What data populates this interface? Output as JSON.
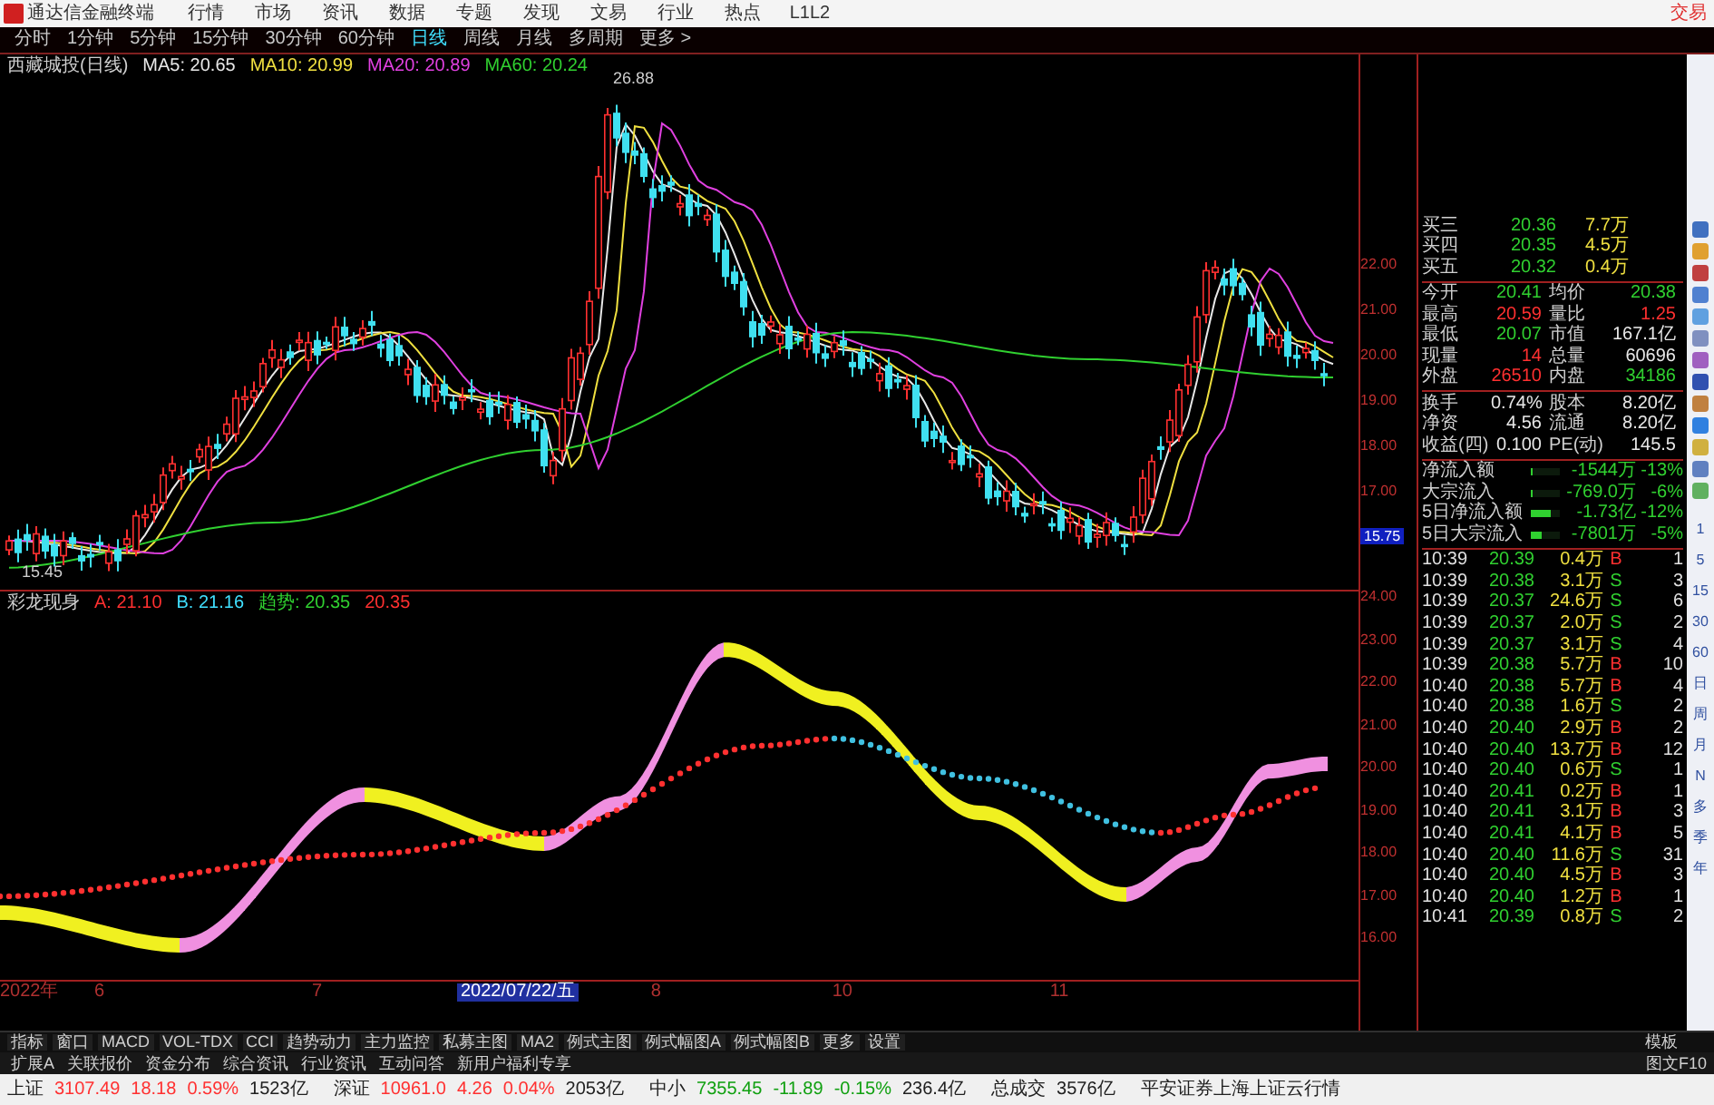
{
  "menu_bar": {
    "app_title": "通达信金融终端",
    "items": [
      "行情",
      "市场",
      "资讯",
      "数据",
      "专题",
      "发现",
      "文易",
      "行业",
      "热点",
      "L1L2"
    ],
    "trade": "交易"
  },
  "period_bar": {
    "items": [
      {
        "label": "分时",
        "selected": false
      },
      {
        "label": "1分钟",
        "selected": false
      },
      {
        "label": "5分钟",
        "selected": false
      },
      {
        "label": "15分钟",
        "selected": false
      },
      {
        "label": "30分钟",
        "selected": false
      },
      {
        "label": "60分钟",
        "selected": false
      },
      {
        "label": "日线",
        "selected": true
      },
      {
        "label": "周线",
        "selected": false
      },
      {
        "label": "月线",
        "selected": false
      },
      {
        "label": "多周期",
        "selected": false
      },
      {
        "label": "更多 >",
        "selected": false
      }
    ]
  },
  "info_bar": {
    "stock": "西藏城投(日线)",
    "ma": [
      {
        "label": "MA5: 20.65",
        "color": "#e8e8e8"
      },
      {
        "label": "MA10: 20.99",
        "color": "#f0e040"
      },
      {
        "label": "MA20: 20.89",
        "color": "#e040e0"
      },
      {
        "label": "MA60: 20.24",
        "color": "#30d030"
      }
    ]
  },
  "main_chart": {
    "high_label": "26.88",
    "low_label": "15.45"
  },
  "price_axis": {
    "labels": [
      "22.00",
      "21.00",
      "20.00",
      "19.00",
      "18.00",
      "17.00"
    ],
    "current": "15.75"
  },
  "indicator": {
    "name": "彩龙现身",
    "values": [
      {
        "text": "A: 21.10",
        "color": "#ff3030"
      },
      {
        "text": "B: 21.16",
        "color": "#40e0ff"
      },
      {
        "text": "趋势: 20.35",
        "color": "#30d030"
      },
      {
        "text": "20.35",
        "color": "#ff3030"
      }
    ]
  },
  "indicator_axis": {
    "labels": [
      "24.00",
      "23.00",
      "22.00",
      "21.00",
      "20.00",
      "19.00",
      "18.00",
      "17.00",
      "16.00"
    ]
  },
  "date_axis": {
    "labels": [
      "2022年",
      "6",
      "7",
      "8",
      "10",
      "11"
    ],
    "cursor": "2022/07/22/五"
  },
  "quote": {
    "book": [
      {
        "label": "买三",
        "price": "20.36",
        "volume": "7.7万"
      },
      {
        "label": "买四",
        "price": "20.35",
        "volume": "4.5万"
      },
      {
        "label": "买五",
        "price": "20.32",
        "volume": "0.4万"
      }
    ],
    "stats": [
      [
        {
          "label": "今开",
          "value": "20.41",
          "color": "#30d030"
        },
        {
          "label": "均价",
          "value": "20.38",
          "color": "#30d030"
        }
      ],
      [
        {
          "label": "最高",
          "value": "20.59",
          "color": "#ff3030"
        },
        {
          "label": "量比",
          "value": "1.25",
          "color": "#ff3030"
        }
      ],
      [
        {
          "label": "最低",
          "value": "20.07",
          "color": "#30d030"
        },
        {
          "label": "市值",
          "value": "167.1亿",
          "color": "#e8e8e8"
        }
      ],
      [
        {
          "label": "现量",
          "value": "14",
          "color": "#ff3030"
        },
        {
          "label": "总量",
          "value": "60696",
          "color": "#e8e8e8"
        }
      ],
      [
        {
          "label": "外盘",
          "value": "26510",
          "color": "#ff3030"
        },
        {
          "label": "内盘",
          "value": "34186",
          "color": "#30d030"
        }
      ]
    ],
    "stats2": [
      [
        {
          "label": "换手",
          "value": "0.74%",
          "color": "#e8e8e8"
        },
        {
          "label": "股本",
          "value": "8.20亿",
          "color": "#e8e8e8"
        }
      ],
      [
        {
          "label": "净资",
          "value": "4.56",
          "color": "#e8e8e8"
        },
        {
          "label": "流通",
          "value": "8.20亿",
          "color": "#e8e8e8"
        }
      ],
      [
        {
          "label": "收益(四)",
          "value": "0.100",
          "color": "#e8e8e8"
        },
        {
          "label": "PE(动)",
          "value": "145.5",
          "color": "#e8e8e8"
        }
      ]
    ],
    "flows": [
      {
        "label": "净流入额",
        "level": 0.05,
        "value": "-1544万",
        "percent": "-13%"
      },
      {
        "label": "大宗流入",
        "level": 0.05,
        "value": "-769.0万",
        "percent": "-6%"
      },
      {
        "label": "5日净流入额",
        "level": 0.7,
        "value": "-1.73亿",
        "percent": "-12%"
      },
      {
        "label": "5日大宗流入",
        "level": 0.4,
        "value": "-7801万",
        "percent": "-5%"
      }
    ],
    "ticks": [
      {
        "time": "10:39",
        "price": "20.39",
        "volume": "0.4万",
        "side": "B",
        "kind": "buy",
        "count": "1"
      },
      {
        "time": "10:39",
        "price": "20.38",
        "volume": "3.1万",
        "side": "S",
        "kind": "sell",
        "count": "3"
      },
      {
        "time": "10:39",
        "price": "20.37",
        "volume": "24.6万",
        "side": "S",
        "kind": "sell",
        "count": "6"
      },
      {
        "time": "10:39",
        "price": "20.37",
        "volume": "2.0万",
        "side": "S",
        "kind": "sell",
        "count": "2"
      },
      {
        "time": "10:39",
        "price": "20.37",
        "volume": "3.1万",
        "side": "S",
        "kind": "sell",
        "count": "4"
      },
      {
        "time": "10:39",
        "price": "20.38",
        "volume": "5.7万",
        "side": "B",
        "kind": "buy",
        "count": "10"
      },
      {
        "time": "10:40",
        "price": "20.38",
        "volume": "5.7万",
        "side": "B",
        "kind": "buy",
        "count": "4"
      },
      {
        "time": "10:40",
        "price": "20.38",
        "volume": "1.6万",
        "side": "S",
        "kind": "sell",
        "count": "2"
      },
      {
        "time": "10:40",
        "price": "20.40",
        "volume": "2.9万",
        "side": "B",
        "kind": "buy",
        "count": "2"
      },
      {
        "time": "10:40",
        "price": "20.40",
        "volume": "13.7万",
        "side": "B",
        "kind": "buy",
        "count": "12"
      },
      {
        "time": "10:40",
        "price": "20.40",
        "volume": "0.6万",
        "side": "S",
        "kind": "sell",
        "count": "1"
      },
      {
        "time": "10:40",
        "price": "20.41",
        "volume": "0.2万",
        "side": "B",
        "kind": "buy",
        "count": "1"
      },
      {
        "time": "10:40",
        "price": "20.41",
        "volume": "3.1万",
        "side": "B",
        "kind": "buy",
        "count": "3"
      },
      {
        "time": "10:40",
        "price": "20.41",
        "volume": "4.1万",
        "side": "B",
        "kind": "buy",
        "count": "5"
      },
      {
        "time": "10:40",
        "price": "20.40",
        "volume": "11.6万",
        "side": "S",
        "kind": "sell",
        "count": "31"
      },
      {
        "time": "10:40",
        "price": "20.40",
        "volume": "4.5万",
        "side": "B",
        "kind": "buy",
        "count": "3"
      },
      {
        "time": "10:40",
        "price": "20.40",
        "volume": "1.2万",
        "side": "B",
        "kind": "buy",
        "count": "1"
      },
      {
        "time": "10:41",
        "price": "20.39",
        "volume": "0.8万",
        "side": "S",
        "kind": "sell",
        "count": "2"
      }
    ]
  },
  "side_toolbar": {
    "periods": [
      "1",
      "5",
      "15",
      "30",
      "60",
      "日",
      "周",
      "月",
      "N",
      "多",
      "季",
      "年"
    ]
  },
  "indicator_tabs": {
    "items": [
      "指标",
      "窗口",
      "MACD",
      "VOL-TDX",
      "CCI",
      "趋势动力",
      "主力监控",
      "私募主图",
      "MA2",
      "例式主图",
      "例式幅图A",
      "例式幅图B",
      "更多",
      "设置"
    ],
    "template": "模板"
  },
  "extension_tabs": {
    "items": [
      "扩展A",
      "关联报价",
      "资金分布",
      "综合资讯",
      "行业资讯",
      "互动问答",
      "新用户福利专享"
    ],
    "f10": "图文F10"
  },
  "status_bar": [
    {
      "name": "上证",
      "value": "3107.49",
      "change": "18.18",
      "percent": "0.59%",
      "amount": "1523亿",
      "color": "#ff3030"
    },
    {
      "name": "深证",
      "value": "10961.0",
      "change": "4.26",
      "percent": "0.04%",
      "amount": "2053亿",
      "color": "#ff3030"
    },
    {
      "name": "中小",
      "value": "7355.45",
      "change": "-11.89",
      "percent": "-0.15%",
      "amount": "236.4亿",
      "color": "#10a010"
    }
  ],
  "total": {
    "label": "总成交",
    "value": "3576亿"
  },
  "broker": "平安证券上海上证云行情"
}
